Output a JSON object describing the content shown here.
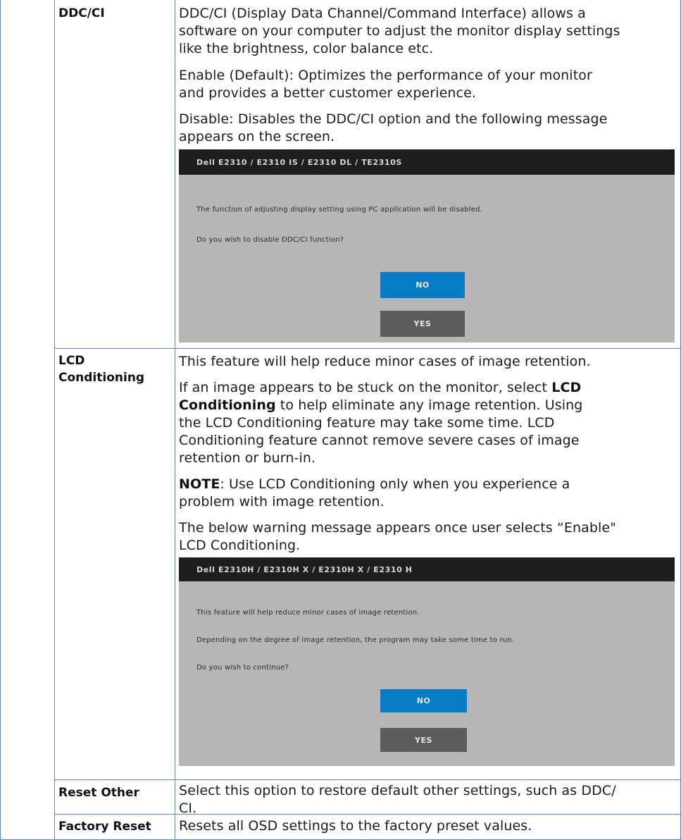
{
  "ddc": {
    "label": "DDC/CI",
    "p1_lines": [
      "DDC/CI (Display Data Channel/Command Interface) allows a",
      "software on your computer to adjust the monitor display settings",
      "like the brightness, color balance etc."
    ],
    "p2_lines": [
      "Enable (Default): Optimizes the performance of your monitor",
      "and provides a better customer experience."
    ],
    "p3_lines": [
      "Disable: Disables the DDC/CI option and the following message",
      "appears on the screen."
    ],
    "dialog": {
      "title": "Dell E2310 / E2310 IS / E2310 DL / TE2310S",
      "line1": "The function of adjusting display setting using PC application will be disabled.",
      "line2": "Do you wish to disable DDC/CI function?",
      "no_label": "NO",
      "yes_label": "YES"
    }
  },
  "lcd": {
    "label_line1": "LCD",
    "label_line2": "Conditioning",
    "p1": "This feature will help reduce minor cases of image retention.",
    "p2_line1_pre": "If an image appears to be stuck on the monitor, select ",
    "p2_line1_bold": "LCD",
    "p2_line2_bold": "Conditioning",
    "p2_line2_post": " to help eliminate any image retention. Using",
    "p2_line3": "the LCD Conditioning feature may take some time. LCD",
    "p2_line4": "Conditioning feature cannot remove  severe cases of image",
    "p2_line5": "retention or burn-in.",
    "note_bold": "NOTE",
    "note_line1": ": Use LCD Conditioning only when you experience a",
    "note_line2": "problem with image retention.",
    "p4_line1": "The below warning message appears once user selects “Enable\"",
    "p4_line2": "LCD Conditioning.",
    "dialog": {
      "title": "Dell E2310H / E2310H X / E2310H X / E2310 H",
      "line1": "This feature will help reduce minor cases of image retention.",
      "line2": "Depending on the degree of image retention, the program may take some time to run.",
      "line3": "Do you wish to continue?",
      "no_label": "NO",
      "yes_label": "YES"
    }
  },
  "reset_other": {
    "label": "Reset Other",
    "line1": "Select this option to restore default other settings, such as DDC/",
    "line2": "CI."
  },
  "factory_reset": {
    "label": "Factory Reset",
    "text": "Resets all OSD settings to the factory preset values."
  },
  "colors": {
    "border": "#5b86c6",
    "no_button": "#0a7bc5",
    "yes_button": "#5c5c5c"
  }
}
